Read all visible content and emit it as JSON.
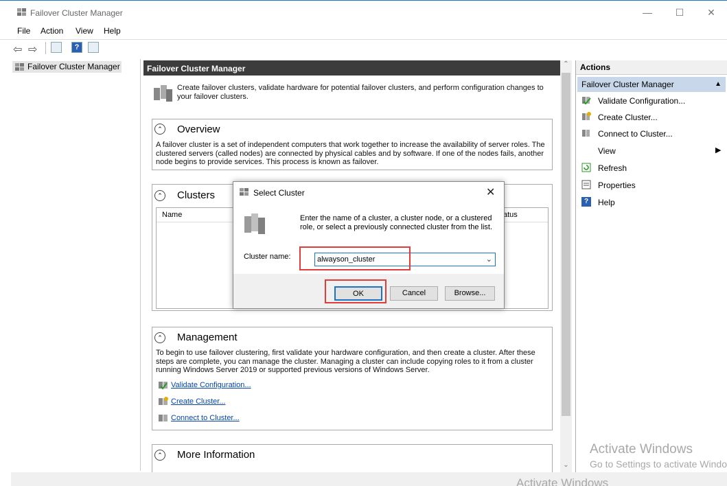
{
  "window": {
    "title": "Failover Cluster Manager",
    "min": "—",
    "max": "☐",
    "close": "✕"
  },
  "menu": [
    "File",
    "Action",
    "View",
    "Help"
  ],
  "tree": {
    "root": "Failover Cluster Manager"
  },
  "center": {
    "header": "Failover Cluster Manager",
    "intro": "Create failover clusters, validate hardware for potential failover clusters, and perform configuration changes to your failover clusters.",
    "overview": {
      "title": "Overview",
      "text": "A failover cluster is a set of independent computers that work together to increase the availability of server roles. The clustered servers (called nodes) are connected by physical cables and by software. If one of the nodes fails, another node begins to provide services. This process is known as failover."
    },
    "clusters": {
      "title": "Clusters",
      "columns": [
        "Name",
        "atus"
      ]
    },
    "management": {
      "title": "Management",
      "text": "To begin to use failover clustering, first validate your hardware configuration, and then create a cluster.  After these steps are complete, you can manage the cluster. Managing a cluster can include copying roles to it from a cluster running Windows Server 2019 or supported previous versions of Windows Server.",
      "links": [
        "Validate Configuration...",
        "Create Cluster...",
        "Connect to Cluster..."
      ]
    },
    "more_info": {
      "title": "More Information"
    }
  },
  "actions": {
    "header": "Actions",
    "group": "Failover Cluster Manager",
    "items": [
      "Validate Configuration...",
      "Create Cluster...",
      "Connect to Cluster...",
      "View",
      "Refresh",
      "Properties",
      "Help"
    ]
  },
  "dialog": {
    "title": "Select Cluster",
    "instruction": "Enter the name of a cluster, a cluster node, or a clustered role, or select a previously connected cluster from the list.",
    "label": "Cluster name:",
    "value": "alwayson_cluster",
    "ok": "OK",
    "cancel": "Cancel",
    "browse": "Browse..."
  },
  "watermark": {
    "line1": "Activate Windows",
    "line2": "Go to Settings to activate Windows.",
    "line3": "Activate Windows"
  },
  "colors": {
    "accent": "#1e73be",
    "highlight": "#e23b3b",
    "header_dark": "#3c3c3c",
    "group_bg": "#c9d7ea"
  },
  "icons": [
    "cluster-icon",
    "back-arrow-icon",
    "forward-arrow-icon",
    "help-icon",
    "refresh-icon",
    "properties-icon",
    "submenu-arrow-icon",
    "collapse-icon"
  ]
}
